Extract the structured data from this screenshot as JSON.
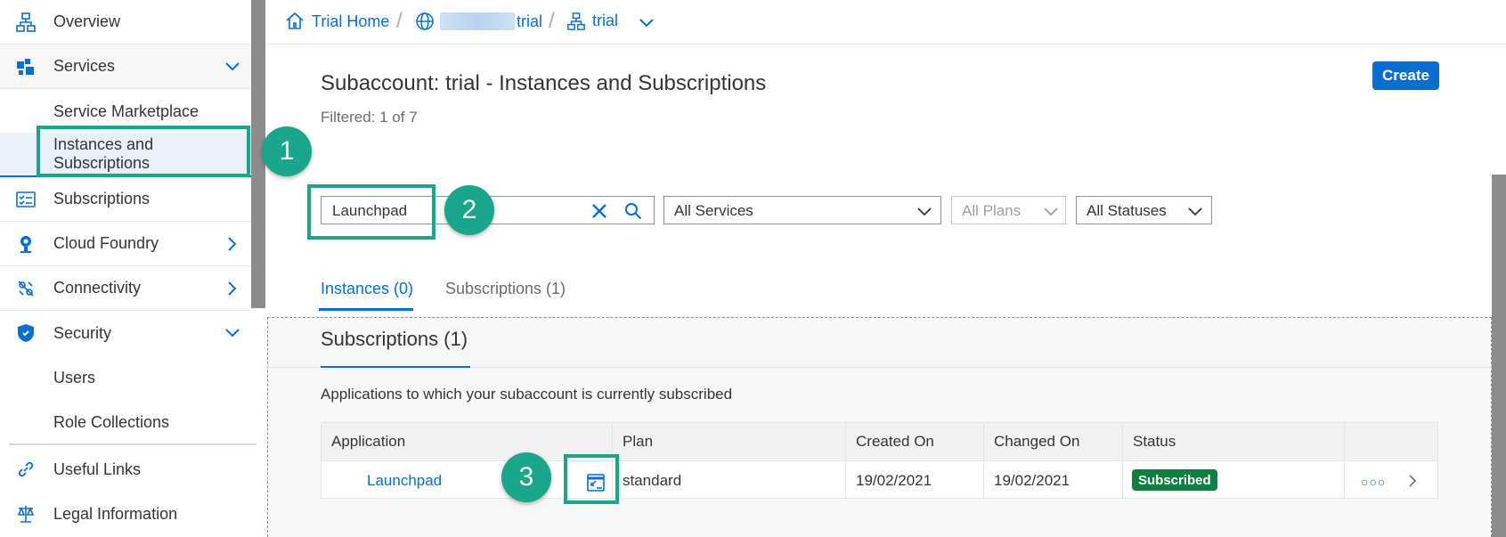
{
  "sidebar": {
    "items": [
      {
        "label": "Overview",
        "icon": "overview-icon"
      },
      {
        "label": "Services",
        "icon": "services-icon"
      },
      {
        "label": "Service Marketplace"
      },
      {
        "label": "Instances and Subscriptions"
      },
      {
        "label": "Subscriptions",
        "icon": "subscriptions-icon"
      },
      {
        "label": "Cloud Foundry",
        "icon": "cloud-foundry-icon"
      },
      {
        "label": "Connectivity",
        "icon": "connectivity-icon"
      },
      {
        "label": "Security",
        "icon": "shield-icon"
      },
      {
        "label": "Users"
      },
      {
        "label": "Role Collections"
      },
      {
        "label": "Useful Links",
        "icon": "link-icon"
      },
      {
        "label": "Legal Information",
        "icon": "legal-icon"
      }
    ]
  },
  "breadcrumb": {
    "home": "Trial Home",
    "global_account": "trial",
    "subaccount": "trial"
  },
  "header": {
    "title": "Subaccount: trial - Instances and Subscriptions",
    "filtered": "Filtered: 1 of 7",
    "create_label": "Create"
  },
  "filters": {
    "search_value": "Launchpad",
    "services": "All Services",
    "plans": "All Plans",
    "statuses": "All Statuses"
  },
  "tabs": [
    {
      "label": "Instances (0)",
      "active": true
    },
    {
      "label": "Subscriptions (1)",
      "active": false
    }
  ],
  "subscriptions": {
    "title": "Subscriptions (1)",
    "description": "Applications to which your subaccount is currently subscribed",
    "columns": [
      "Application",
      "Plan",
      "Created On",
      "Changed On",
      "Status"
    ],
    "rows": [
      {
        "application": "Launchpad",
        "plan": "standard",
        "created_on": "19/02/2021",
        "changed_on": "19/02/2021",
        "status": "Subscribed",
        "more": "○○○"
      }
    ]
  },
  "callouts": [
    "1",
    "2",
    "3"
  ],
  "colors": {
    "accent": "#0a6ed1",
    "callout": "#1aa68a",
    "status_success": "#107e3e"
  }
}
